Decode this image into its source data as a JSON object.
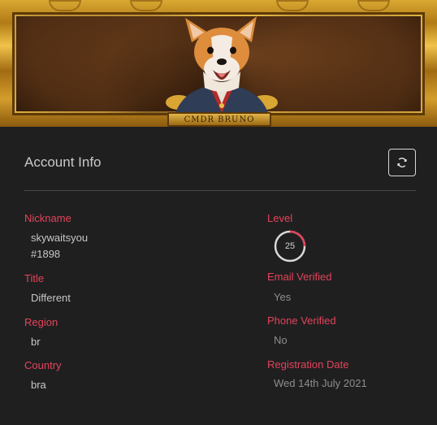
{
  "banner": {
    "plaque_text": "CMDR BRUNO"
  },
  "header": {
    "title": "Account Info",
    "refresh_icon": "refresh-icon"
  },
  "fields": {
    "nickname": {
      "label": "Nickname",
      "value_line1": "skywaitsyou",
      "value_line2": "#1898"
    },
    "title": {
      "label": "Title",
      "value": "Different"
    },
    "region": {
      "label": "Region",
      "value": "br"
    },
    "country": {
      "label": "Country",
      "value": "bra"
    },
    "level": {
      "label": "Level",
      "value": "25",
      "progress": 0.25
    },
    "email_verified": {
      "label": "Email Verified",
      "value": "Yes"
    },
    "phone_verified": {
      "label": "Phone Verified",
      "value": "No"
    },
    "registration_date": {
      "label": "Registration Date",
      "value": "Wed 14th July 2021"
    }
  },
  "colors": {
    "accent": "#e2445a",
    "background": "#201f20",
    "ring_track": "#d9d9d9",
    "ring_progress": "#e2445a"
  }
}
